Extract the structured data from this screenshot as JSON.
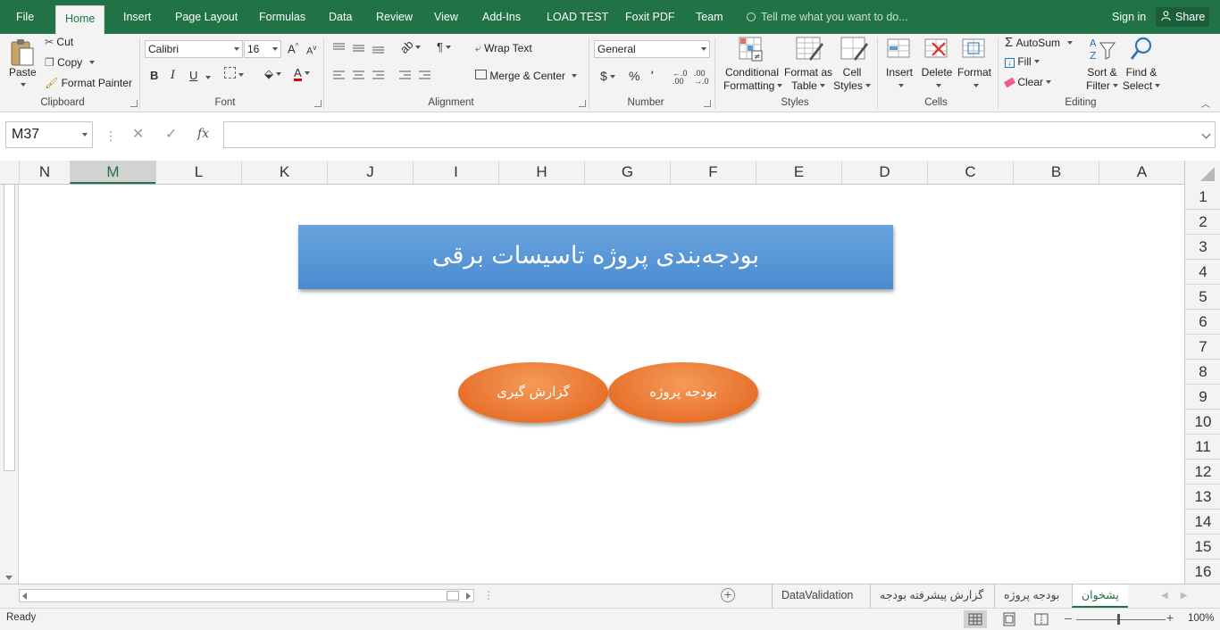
{
  "menu": {
    "tabs": [
      "File",
      "Home",
      "Insert",
      "Page Layout",
      "Formulas",
      "Data",
      "Review",
      "View",
      "Add-Ins",
      "LOAD TEST",
      "Foxit PDF",
      "Team"
    ],
    "active_tab": "Home",
    "tell_me": "Tell me what you want to do...",
    "sign_in": "Sign in",
    "share": "Share"
  },
  "ribbon": {
    "clipboard": {
      "label": "Clipboard",
      "paste": "Paste",
      "cut": "Cut",
      "copy": "Copy",
      "format_painter": "Format Painter"
    },
    "font": {
      "label": "Font",
      "family": "Calibri",
      "size": "16",
      "bold": "B",
      "italic": "I",
      "underline": "U",
      "grow": "A",
      "shrink": "A"
    },
    "alignment": {
      "label": "Alignment",
      "wrap_text": "Wrap Text",
      "merge_center": "Merge & Center"
    },
    "number": {
      "label": "Number",
      "format": "General",
      "currency": "$",
      "percent": "%",
      "comma": "٬"
    },
    "styles": {
      "label": "Styles",
      "conditional_formatting": [
        "Conditional",
        "Formatting"
      ],
      "format_as_table": [
        "Format as",
        "Table"
      ],
      "cell_styles": [
        "Cell",
        "Styles"
      ]
    },
    "cells": {
      "label": "Cells",
      "insert": "Insert",
      "delete": "Delete",
      "format": "Format"
    },
    "editing": {
      "label": "Editing",
      "autosum": "AutoSum",
      "fill": "Fill",
      "clear": "Clear",
      "sort_filter": [
        "Sort &",
        "Filter"
      ],
      "find_select": [
        "Find &",
        "Select"
      ]
    }
  },
  "formula_bar": {
    "name_box": "M37",
    "fx": "fx",
    "formula": ""
  },
  "grid": {
    "columns": [
      "N",
      "M",
      "L",
      "K",
      "J",
      "I",
      "H",
      "G",
      "F",
      "E",
      "D",
      "C",
      "B",
      "A"
    ],
    "selected_column": "M",
    "rows": [
      "1",
      "2",
      "3",
      "4",
      "5",
      "6",
      "7",
      "8",
      "9",
      "10",
      "11",
      "12",
      "13",
      "14",
      "15",
      "16"
    ]
  },
  "sheet_content": {
    "title": "بودجه‌بندی پروژه تاسیسات برقی",
    "button_report": "گزارش گیری",
    "button_budget": "بودجه پروژه"
  },
  "colors": {
    "excel_green": "#217346",
    "banner_blue": "#5b9bd5",
    "oval_orange": "#ed7d31"
  },
  "sheet_tabs": [
    "DataValidation",
    "گزارش پیشرفته بودجه",
    "بودجه پروژه",
    "پشخوان"
  ],
  "active_sheet": "پشخوان",
  "status": {
    "text": "Ready",
    "zoom": "100%"
  }
}
